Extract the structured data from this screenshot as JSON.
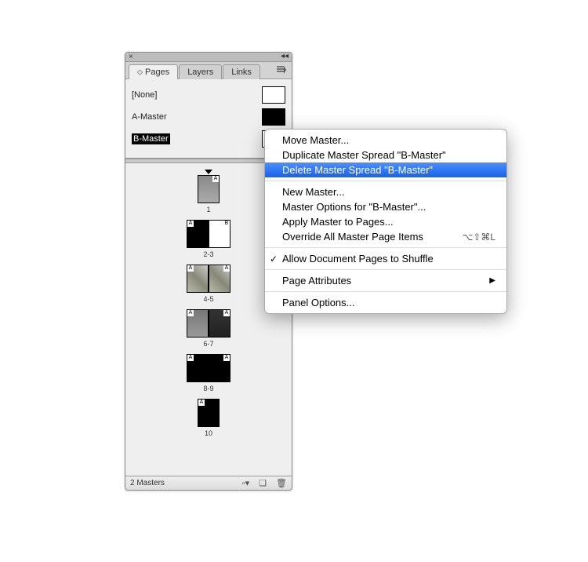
{
  "tabs": {
    "pages": "Pages",
    "layers": "Layers",
    "links": "Links"
  },
  "masters": {
    "none": "[None]",
    "a": "A-Master",
    "b": "B-Master"
  },
  "pages": {
    "p1": "1",
    "p23": "2-3",
    "p45": "4-5",
    "p67": "6-7",
    "p89": "8-9",
    "p10": "10",
    "badgeA": "A",
    "badgeB": "B"
  },
  "footer": {
    "status": "2 Masters"
  },
  "menu": {
    "move": "Move Master...",
    "duplicate": "Duplicate Master Spread \"B-Master\"",
    "delete": "Delete Master Spread \"B-Master\"",
    "new": "New Master...",
    "options": "Master Options for \"B-Master\"...",
    "apply": "Apply Master to Pages...",
    "override": "Override All Master Page Items",
    "override_shortcut": "⌥⇧⌘L",
    "shuffle": "Allow Document Pages to Shuffle",
    "attributes": "Page Attributes",
    "panel_options": "Panel Options..."
  }
}
